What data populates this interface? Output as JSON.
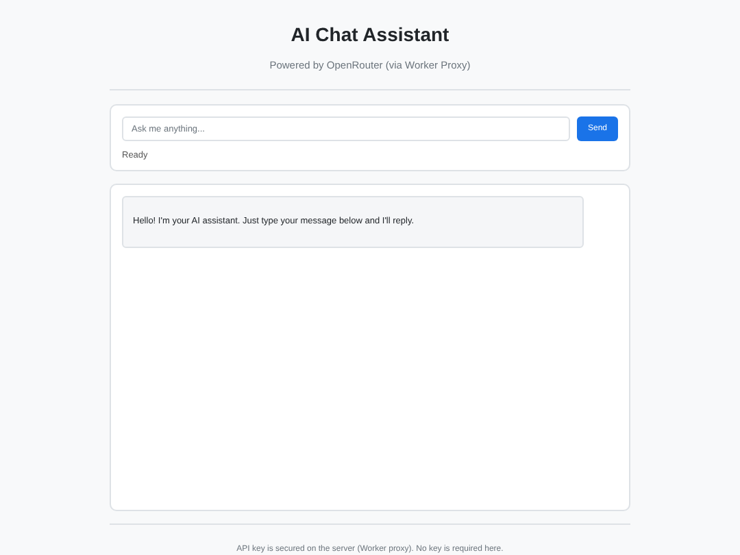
{
  "header": {
    "title": "AI Chat Assistant",
    "subtitle": "Powered by OpenRouter (via Worker Proxy)"
  },
  "composer": {
    "placeholder": "Ask me anything...",
    "send_label": "Send",
    "status": "Ready"
  },
  "messages": [
    {
      "kind": "assistant",
      "text": "Hello! I'm your AI assistant. Just type your message below and I'll reply."
    }
  ],
  "footer": "API key is secured on the server (Worker proxy). No key is required here."
}
